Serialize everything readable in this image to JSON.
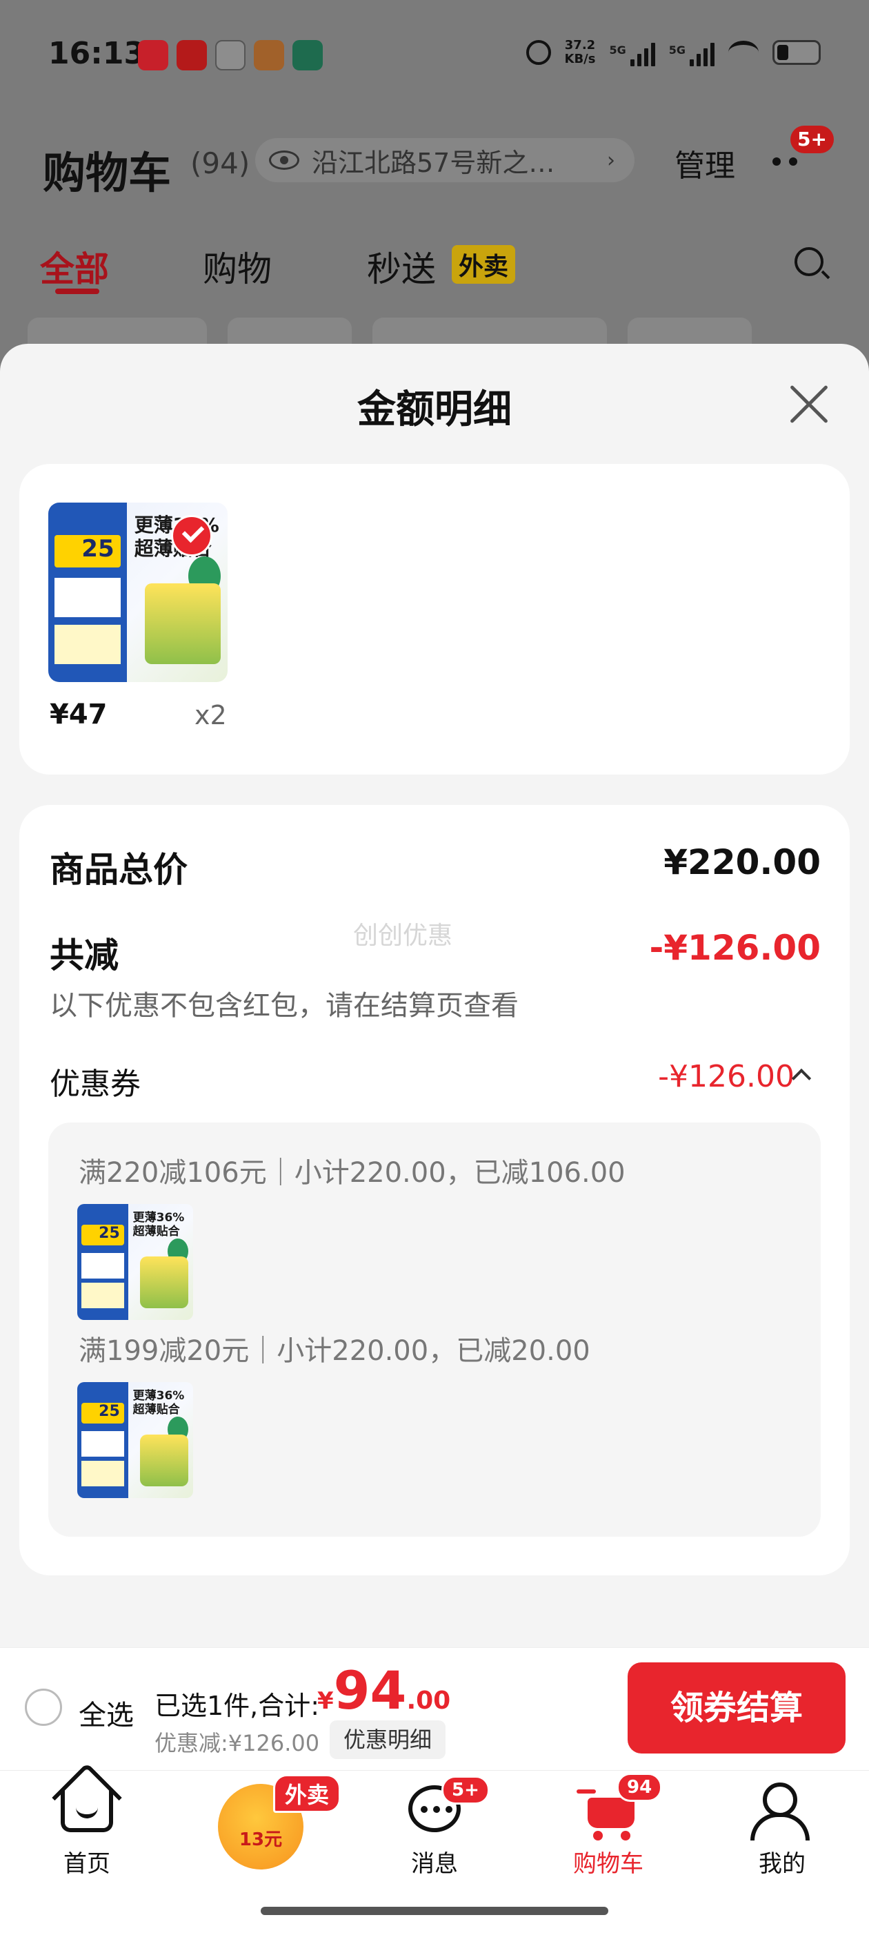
{
  "status_bar": {
    "time": "16:13",
    "net_speed_value": "37.2",
    "net_speed_unit": "KB/s",
    "signal_1_label": "5G",
    "signal_2_label": "5G",
    "app_icons": [
      "mail-app-icon",
      "lazy-app-icon",
      "clock-app-icon",
      "game-app-icon",
      "bank-app-icon"
    ]
  },
  "cart_header": {
    "title": "购物车",
    "count": "(94)",
    "address": "沿江北路57号新之…",
    "manage_label": "管理",
    "more_badge": "5+"
  },
  "tabs": [
    {
      "label": "全部",
      "active": true
    },
    {
      "label": "购物",
      "active": false
    },
    {
      "label": "秒送",
      "active": false
    }
  ],
  "waimai_tag": "外卖",
  "sheet": {
    "title": "金额明细",
    "item": {
      "price": "¥47",
      "qty": "x2"
    },
    "summary": {
      "total_label": "商品总价",
      "total_value": "¥220.00",
      "reduce_label": "共减",
      "reduce_value": "-¥126.00",
      "note": "以下优惠不包含红包，请在结算页查看",
      "coupon_label": "优惠券",
      "coupon_value": "-¥126.00",
      "watermark": "创创优惠"
    },
    "coupons": [
      {
        "rule": "满220减106元｜小计220.00，已减106.00"
      },
      {
        "rule": "满199减20元｜小计220.00，已减20.00"
      }
    ]
  },
  "checkout": {
    "select_all": "全选",
    "selected_prefix": "已选1件,合计:",
    "currency": "¥",
    "total_int": "94",
    "total_dec": ".00",
    "discount": "优惠减:¥126.00",
    "detail_button": "优惠明细",
    "checkout_button": "领券结算"
  },
  "tabbar": {
    "home": "首页",
    "waimai_badge": "外卖",
    "waimai_amount": "13元",
    "messages": "消息",
    "messages_badge": "5+",
    "cart": "购物车",
    "cart_badge": "94",
    "me": "我的"
  },
  "colors": {
    "accent_red": "#e8252d",
    "dim_overlay": "#7f7f7f"
  }
}
